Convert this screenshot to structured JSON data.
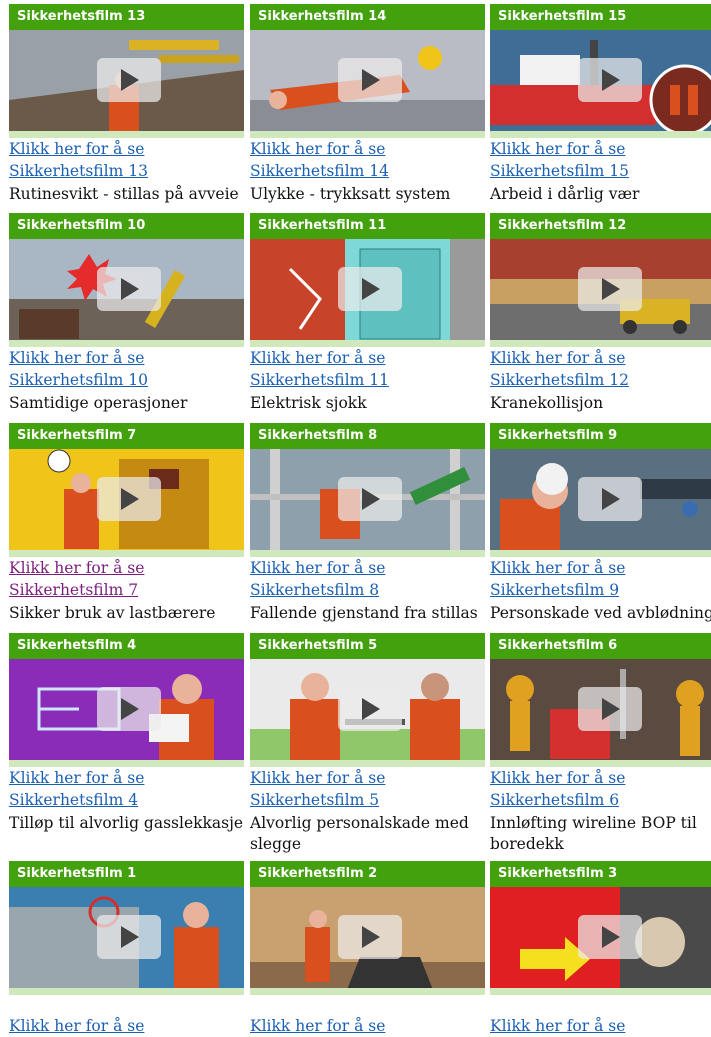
{
  "link_prefix": "Klikk her for å se",
  "rows": [
    [
      {
        "title": "Sikkerhetsfilm 13",
        "desc": "Rutinesvikt - stillas på avveie",
        "icon": "scaffold-scene",
        "visited": false
      },
      {
        "title": "Sikkerhetsfilm 14",
        "desc": "Ulykke - trykksatt system",
        "icon": "injured-worker-scene",
        "visited": false
      },
      {
        "title": "Sikkerhetsfilm 15",
        "desc": "Arbeid i dårlig vær",
        "icon": "ship-scene",
        "visited": false
      }
    ],
    [
      {
        "title": "Sikkerhetsfilm 10",
        "desc": "Samtidige operasjoner",
        "icon": "explosion-scene",
        "visited": false
      },
      {
        "title": "Sikkerhetsfilm 11",
        "desc": "Elektrisk sjokk",
        "icon": "electric-panel-scene",
        "visited": false
      },
      {
        "title": "Sikkerhetsfilm 12",
        "desc": "Kranekollisjon",
        "icon": "crane-deck-scene",
        "visited": false
      }
    ],
    [
      {
        "title": "Sikkerhetsfilm 7",
        "desc": "Sikker bruk av lastbærere",
        "icon": "container-scene",
        "visited": true
      },
      {
        "title": "Sikkerhetsfilm 8",
        "desc": "Fallende gjenstand fra stillas",
        "icon": "falling-object-scene",
        "visited": false
      },
      {
        "title": "Sikkerhetsfilm 9",
        "desc": "Personskade ved avblødning",
        "icon": "headset-worker-scene",
        "visited": false
      }
    ],
    [
      {
        "title": "Sikkerhetsfilm 4",
        "desc": "Tilløp til alvorlig gasslekkasje",
        "icon": "gas-diagram-scene",
        "visited": false
      },
      {
        "title": "Sikkerhetsfilm 5",
        "desc": "Alvorlig personalskade med slegge",
        "icon": "sledgehammer-scene",
        "visited": false
      },
      {
        "title": "Sikkerhetsfilm 6",
        "desc": "Innløfting wireline BOP til boredekk",
        "icon": "bop-lift-scene",
        "visited": false
      }
    ],
    [
      {
        "title": "Sikkerhetsfilm 1",
        "desc": "",
        "icon": "machine-room-scene",
        "visited": false
      },
      {
        "title": "Sikkerhetsfilm 2",
        "desc": "",
        "icon": "hall-scene",
        "visited": false
      },
      {
        "title": "Sikkerhetsfilm 3",
        "desc": "",
        "icon": "arrow-hose-scene",
        "visited": false
      }
    ]
  ],
  "colors": {
    "bar": "#43a10e",
    "link": "#1a5fb4",
    "visited": "#7b1e7b"
  }
}
